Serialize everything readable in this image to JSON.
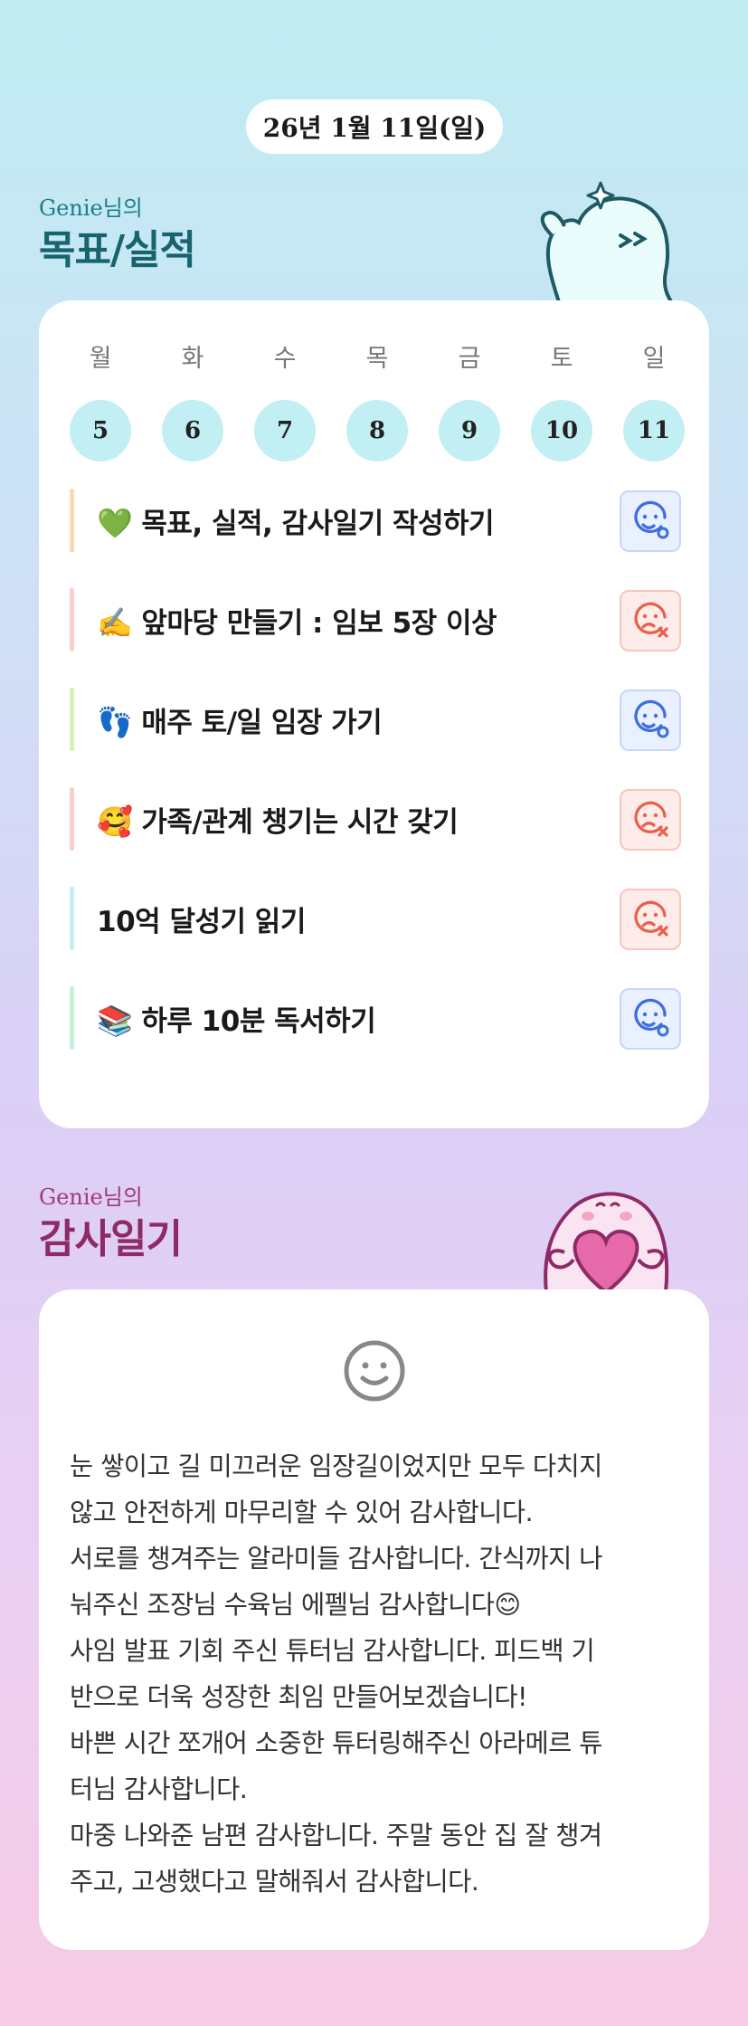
{
  "date_label": "26년 1월 11일(일)",
  "goals_section": {
    "subtitle": "Genie님의",
    "title": "목표/실적"
  },
  "week": {
    "days": [
      "월",
      "화",
      "수",
      "목",
      "금",
      "토",
      "일"
    ],
    "dates": [
      "5",
      "6",
      "7",
      "8",
      "9",
      "10",
      "11"
    ]
  },
  "goals": [
    {
      "emoji": "💚",
      "text": "목표, 실적, 감사일기 작성하기",
      "status": "done",
      "bar_color": "#fbd9b3"
    },
    {
      "emoji": "✍️",
      "text": "앞마당 만들기 : 임보 5장 이상",
      "status": "missed",
      "bar_color": "#fbd0cc"
    },
    {
      "emoji": "👣",
      "text": "매주 토/일 임장 가기",
      "status": "done",
      "bar_color": "#d6f2b8"
    },
    {
      "emoji": "🥰",
      "text": "가족/관계 챙기는 시간 갖기",
      "status": "missed",
      "bar_color": "#fbd0cc"
    },
    {
      "emoji": "",
      "text": "10억 달성기 읽기",
      "status": "missed",
      "bar_color": "#c6eef2"
    },
    {
      "emoji": "📚",
      "text": "하루 10분 독서하기",
      "status": "done",
      "bar_color": "#c6f0d8"
    }
  ],
  "diary_section": {
    "subtitle": "Genie님의",
    "title": "감사일기"
  },
  "diary": {
    "text": "눈 쌓이고 길 미끄러운 임장길이었지만 모두 다치지\n않고 안전하게 마무리할 수 있어 감사합니다.\n서로를 챙겨주는 알라미들 감사합니다. 간식까지 나\n눠주신 조장님 수육님 에펠님 감사합니다😊\n사임 발표 기회 주신 튜터님 감사합니다. 피드백 기\n반으로 더욱 성장한 최임 만들어보겠습니다!\n바쁜 시간 쪼개어 소중한 튜터링해주신 아라메르 튜\n터님 감사합니다.\n마중 나와준 남편 감사합니다. 주말 동안 집 잘 챙겨\n주고, 고생했다고 말해줘서 감사합니다."
  },
  "colors": {
    "teal": "#1a7e86",
    "magenta": "#a13a76",
    "done": "#3d6ee0",
    "missed": "#e8604c"
  },
  "icons": {
    "done": "smile-check-icon",
    "missed": "sad-x-icon",
    "diary": "smiley-icon"
  }
}
